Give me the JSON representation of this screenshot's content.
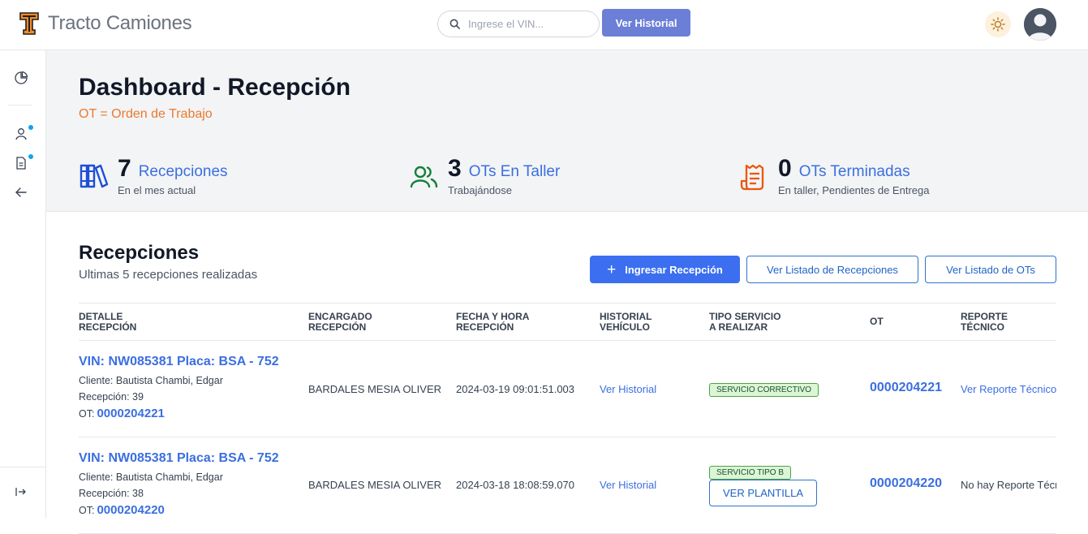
{
  "header": {
    "brand_name": "Tracto Camiones",
    "search_placeholder": "Ingrese el VIN...",
    "history_button": "Ver Historial",
    "theme_icon": "sun-icon",
    "avatar_icon": "user-avatar"
  },
  "sidebar": {
    "items": [
      {
        "icon": "pie-chart-icon"
      },
      {
        "icon": "user-icon"
      },
      {
        "icon": "document-icon"
      },
      {
        "icon": "arrow-left-icon"
      },
      {
        "icon": "logout-icon"
      }
    ]
  },
  "hero": {
    "title": "Dashboard - Recepción",
    "subtitle": "OT = Orden de Trabajo",
    "stats": [
      {
        "value": "7",
        "label": "Recepciones",
        "caption": "En el mes actual",
        "icon": "books-icon",
        "color": "#1d4ed8"
      },
      {
        "value": "3",
        "label": "OTs En Taller",
        "caption": "Trabajándose",
        "icon": "users-icon",
        "color": "#15803d"
      },
      {
        "value": "0",
        "label": "OTs Terminadas",
        "caption": "En taller, Pendientes de Entrega",
        "icon": "receipt-icon",
        "color": "#ea580c"
      }
    ]
  },
  "section": {
    "title": "Recepciones",
    "subtitle": "Ultimas 5 recepciones realizadas",
    "btn_add": "Ingresar Recepción",
    "btn_list_recepciones": "Ver Listado de Recepciones",
    "btn_list_ots": "Ver Listado de OTs"
  },
  "table": {
    "headers": {
      "detalle": [
        "DETALLE",
        "RECEPCIÓN"
      ],
      "encargado": [
        "ENCARGADO",
        "RECEPCIÓN"
      ],
      "fecha": [
        "FECHA Y HORA",
        "RECEPCIÓN"
      ],
      "historial": [
        "HISTORIAL",
        "VEHÍCULO"
      ],
      "tipo": [
        "TIPO SERVICIO",
        "A REALIZAR"
      ],
      "ot": "OT",
      "reporte": [
        "REPORTE",
        "TÉCNICO"
      ]
    },
    "rows": [
      {
        "vin": "VIN: NW085381  Placa: BSA - 752",
        "cliente": "Cliente: Bautista Chambi, Edgar",
        "recepcion": "Recepción: 39",
        "ot_label": "OT:",
        "ot": "0000204221",
        "encargado": "BARDALES MESIA OLIVER",
        "fecha": "2024-03-19 09:01:51.003",
        "historial": "Ver Historial",
        "tipo": "SERVICIO CORRECTIVO",
        "plantilla": "",
        "ot_col": "0000204221",
        "reporte": "Ver Reporte Técnico"
      },
      {
        "vin": "VIN: NW085381  Placa: BSA - 752",
        "cliente": "Cliente: Bautista Chambi, Edgar",
        "recepcion": "Recepción: 38",
        "ot_label": "OT:",
        "ot": "0000204220",
        "encargado": "BARDALES MESIA OLIVER",
        "fecha": "2024-03-18 18:08:59.070",
        "historial": "Ver Historial",
        "tipo": "SERVICIO TIPO B",
        "plantilla": "VER PLANTILLA",
        "ot_col": "0000204220",
        "reporte": "No hay Reporte Técr"
      }
    ]
  }
}
